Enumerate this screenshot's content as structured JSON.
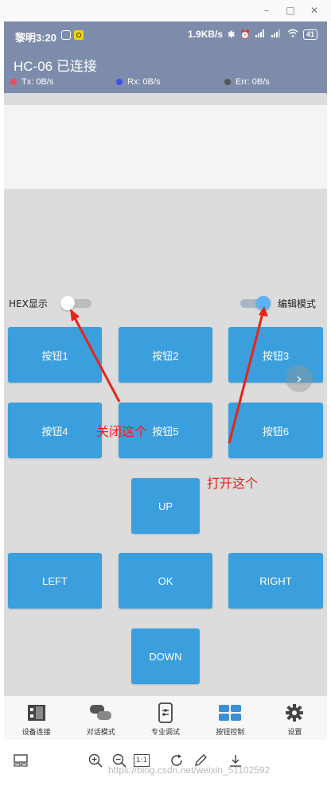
{
  "window": {
    "minimize_glyph": "–",
    "maximize_glyph": "□",
    "close_glyph": "✕"
  },
  "status_bar": {
    "time": "黎明3:20",
    "network_speed": "1.9KB/s",
    "battery": "41"
  },
  "header": {
    "title": "HC-06 已连接",
    "stats": [
      {
        "label": "Tx: 0B/s",
        "color": "#ef4a5a"
      },
      {
        "label": "Rx: 0B/s",
        "color": "#3f4ee8"
      },
      {
        "label": "Err: 0B/s",
        "color": "#555555"
      }
    ]
  },
  "receive_area": {
    "value": ""
  },
  "toggles": {
    "hex_label": "HEX显示",
    "hex_on": false,
    "edit_label": "编辑模式",
    "edit_on": true
  },
  "buttons": {
    "b1": "按钮1",
    "b2": "按钮2",
    "b3": "按钮3",
    "b4": "按钮4",
    "b5": "按钮5",
    "b6": "按钮6",
    "up": "UP",
    "left": "LEFT",
    "ok": "OK",
    "right": "RIGHT",
    "down": "DOWN"
  },
  "pager_glyph": "›",
  "annotations": {
    "close_this": "关闭这个",
    "open_this": "打开这个",
    "color": "#e8231a"
  },
  "bottom_nav": [
    {
      "label": "设备连接",
      "icon": "device-connect-icon"
    },
    {
      "label": "对话模式",
      "icon": "chat-bubbles-icon"
    },
    {
      "label": "专业调试",
      "icon": "debug-panel-icon"
    },
    {
      "label": "按钮控制",
      "icon": "button-grid-icon",
      "active": true
    },
    {
      "label": "设置",
      "icon": "gear-icon"
    }
  ],
  "viewer": {
    "actual_size_label": "1:1",
    "watermark": "https://blog.csdn.net/weixin_51102592"
  },
  "colors": {
    "header_bg": "#7d8cab",
    "button_bg": "#3a9fdc",
    "toggle_on": "#5ab4f5",
    "active_nav": "#3a8fd6"
  }
}
